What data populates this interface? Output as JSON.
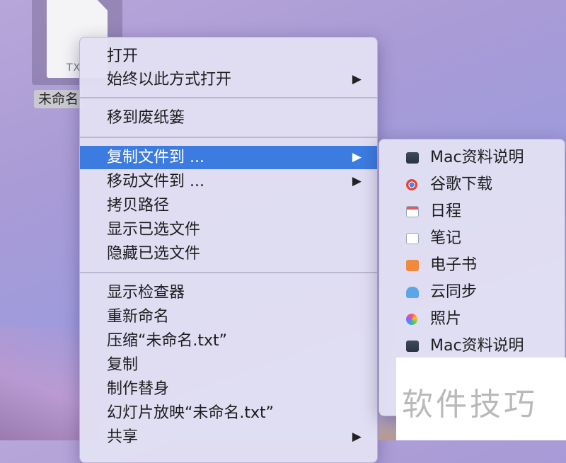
{
  "desktop": {
    "file_ext": "TX",
    "file_label": "未命名"
  },
  "context_menu": {
    "items": [
      {
        "label": "打开",
        "submenu": false
      },
      {
        "label": "始终以此方式打开",
        "submenu": true
      },
      {
        "label": "移到废纸篓",
        "submenu": false
      },
      {
        "label": "复制文件到 ...",
        "submenu": true,
        "active": true
      },
      {
        "label": "移动文件到 ...",
        "submenu": true
      },
      {
        "label": "拷贝路径",
        "submenu": false
      },
      {
        "label": "显示已选文件",
        "submenu": false
      },
      {
        "label": "隐藏已选文件",
        "submenu": false
      },
      {
        "label": "显示检查器",
        "submenu": false
      },
      {
        "label": "重新命名",
        "submenu": false
      },
      {
        "label": "压缩“未命名.txt”",
        "submenu": false
      },
      {
        "label": "复制",
        "submenu": false
      },
      {
        "label": "制作替身",
        "submenu": false
      },
      {
        "label": "幻灯片放映“未命名.txt”",
        "submenu": false
      },
      {
        "label": "共享",
        "submenu": true
      }
    ],
    "submenu_arrow": "▶"
  },
  "copy_to_submenu": {
    "items": [
      {
        "label": "Mac资料说明",
        "icon": "film-folder-icon"
      },
      {
        "label": "谷歌下载",
        "icon": "chrome-icon"
      },
      {
        "label": "日程",
        "icon": "calendar-icon"
      },
      {
        "label": "笔记",
        "icon": "notes-icon"
      },
      {
        "label": "电子书",
        "icon": "books-icon"
      },
      {
        "label": "云同步",
        "icon": "cloud-icon"
      },
      {
        "label": "照片",
        "icon": "photos-icon"
      },
      {
        "label": "Mac资料说明",
        "icon": "film-folder-icon"
      }
    ]
  },
  "watermark": {
    "text": "软件技巧"
  },
  "colors": {
    "highlight": "#3c7be0",
    "menu_bg": "#e2e0f2"
  }
}
